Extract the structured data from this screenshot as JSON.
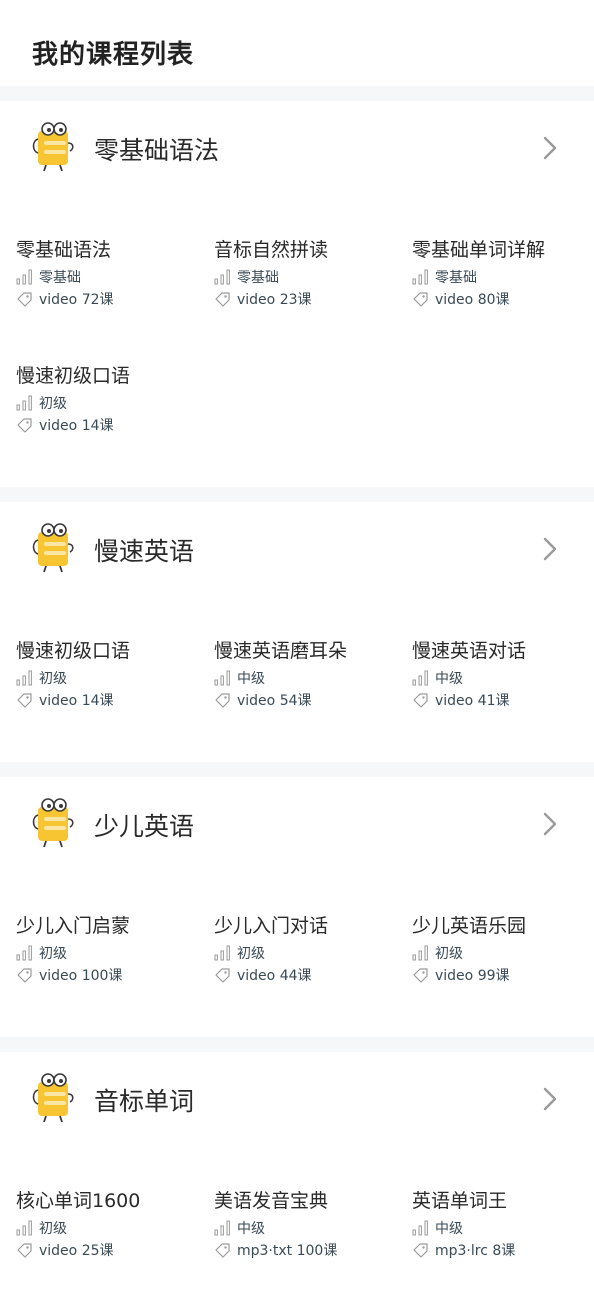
{
  "page": {
    "title": "我的课程列表"
  },
  "colors": {
    "mascot_yellow": "#f7c531",
    "mascot_dark": "#3a3a3a",
    "text_primary": "#2a2a2a",
    "meta_text": "#3a4a55",
    "icon_gray": "#9a9a9a"
  },
  "sections": [
    {
      "title": "零基础语法",
      "courses": [
        {
          "title": "零基础语法",
          "level": "零基础",
          "info": "video 72课"
        },
        {
          "title": "音标自然拼读",
          "level": "零基础",
          "info": "video 23课"
        },
        {
          "title": "零基础单词详解",
          "level": "零基础",
          "info": "video 80课"
        },
        {
          "title": "慢速初级口语",
          "level": "初级",
          "info": "video 14课"
        }
      ]
    },
    {
      "title": "慢速英语",
      "courses": [
        {
          "title": "慢速初级口语",
          "level": "初级",
          "info": "video 14课"
        },
        {
          "title": "慢速英语磨耳朵",
          "level": "中级",
          "info": "video 54课"
        },
        {
          "title": "慢速英语对话",
          "level": "中级",
          "info": "video 41课"
        }
      ]
    },
    {
      "title": "少儿英语",
      "courses": [
        {
          "title": "少儿入门启蒙",
          "level": "初级",
          "info": "video 100课"
        },
        {
          "title": "少儿入门对话",
          "level": "初级",
          "info": "video 44课"
        },
        {
          "title": "少儿英语乐园",
          "level": "初级",
          "info": "video 99课"
        }
      ]
    },
    {
      "title": "音标单词",
      "courses": [
        {
          "title": "核心单词1600",
          "level": "初级",
          "info": "video 25课"
        },
        {
          "title": "美语发音宝典",
          "level": "中级",
          "info": "mp3·txt 100课"
        },
        {
          "title": "英语单词王",
          "level": "中级",
          "info": "mp3·lrc 8课"
        }
      ]
    }
  ]
}
